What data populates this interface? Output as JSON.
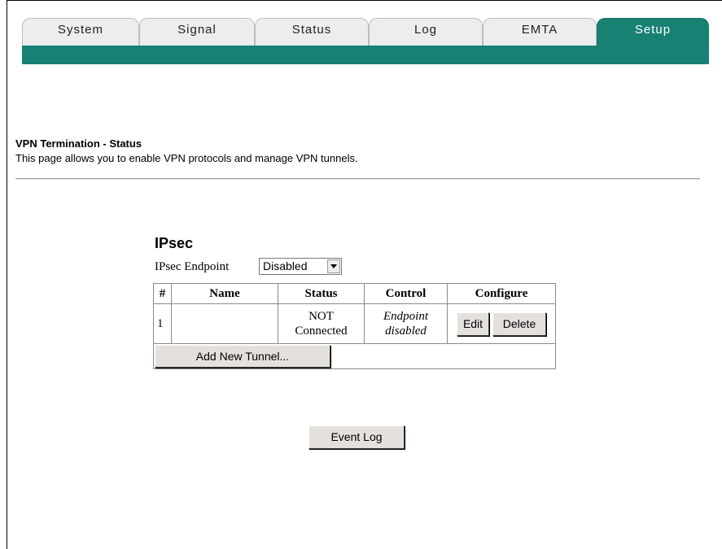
{
  "tabs": [
    {
      "label": "System",
      "active": false
    },
    {
      "label": "Signal",
      "active": false
    },
    {
      "label": "Status",
      "active": false
    },
    {
      "label": "Log",
      "active": false
    },
    {
      "label": "EMTA",
      "active": false
    },
    {
      "label": "Setup",
      "active": true
    }
  ],
  "colors": {
    "tab_active": "#178173",
    "tab_inactive": "#ededed",
    "tab_bar": "#178173"
  },
  "section": {
    "title": "VPN Termination - Status",
    "description": "This page allows you to enable VPN protocols and manage VPN tunnels."
  },
  "ipsec": {
    "title": "IPsec",
    "endpoint_label": "IPsec Endpoint",
    "endpoint_value": "Disabled",
    "table": {
      "headers": [
        "#",
        "Name",
        "Status",
        "Control",
        "Configure"
      ],
      "rows": [
        {
          "num": "1",
          "name": "",
          "status_line1": "NOT",
          "status_line2": "Connected",
          "control_line1": "Endpoint",
          "control_line2": "disabled",
          "edit_label": "Edit",
          "delete_label": "Delete"
        }
      ]
    },
    "add_tunnel_label": "Add New Tunnel..."
  },
  "event_log_label": "Event Log"
}
